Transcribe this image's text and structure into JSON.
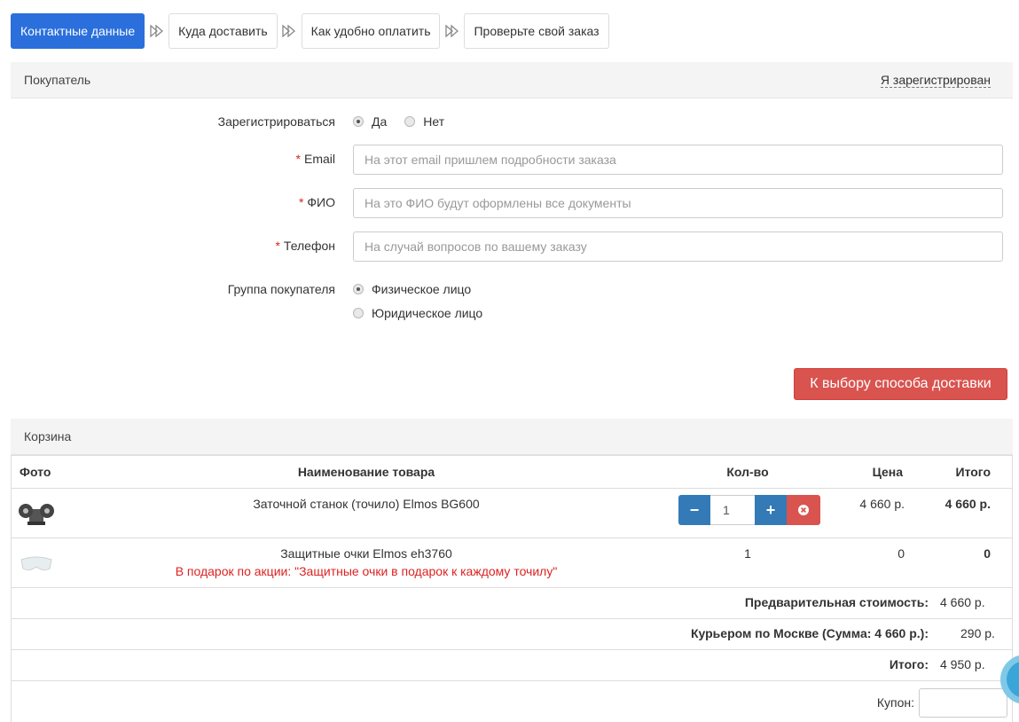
{
  "steps": [
    {
      "label": "Контактные данные",
      "active": true
    },
    {
      "label": "Куда доставить",
      "active": false
    },
    {
      "label": "Как удобно оплатить",
      "active": false
    },
    {
      "label": "Проверьте свой заказ",
      "active": false
    }
  ],
  "buyer": {
    "title": "Покупатель",
    "registered_link": "Я зарегистрирован",
    "register_label": "Зарегистрироваться",
    "register_yes": "Да",
    "register_no": "Нет",
    "email_label": "Email",
    "email_placeholder": "На этот email пришлем подробности заказа",
    "fio_label": "ФИО",
    "fio_placeholder": "На это ФИО будут оформлены все документы",
    "phone_label": "Телефон",
    "phone_placeholder": "На случай вопросов по вашему заказу",
    "required_mark": "*",
    "group_label": "Группа покупателя",
    "group_individual": "Физическое лицо",
    "group_legal": "Юридическое лицо",
    "next_button": "К выбору способа доставки"
  },
  "cart": {
    "title": "Корзина",
    "columns": {
      "photo": "Фото",
      "name": "Наименование товара",
      "qty": "Кол-во",
      "price": "Цена",
      "total": "Итого"
    },
    "items": [
      {
        "name": "Заточной станок (точило) Elmos BG600",
        "qty": "1",
        "price": "4 660 р.",
        "total": "4 660 р."
      },
      {
        "name": "Защитные очки Elmos eh3760",
        "gift_note": "В подарок по акции: \"Защитные очки в подарок к каждому точилу\"",
        "qty": "1",
        "price": "0",
        "total": "0"
      }
    ],
    "qty_minus": "−",
    "qty_plus": "+",
    "summary": {
      "subtotal_label": "Предварительная стоимость:",
      "subtotal_value": "4 660 р.",
      "delivery_label": "Курьером по Москве (Сумма: 4 660 р.):",
      "delivery_value": "290 р.",
      "total_label": "Итого:",
      "total_value": "4 950 р.",
      "coupon_label": "Купон:"
    }
  },
  "colors": {
    "accent": "#2a6fdc",
    "danger": "#d9534f",
    "qty_button": "#337ab7"
  }
}
